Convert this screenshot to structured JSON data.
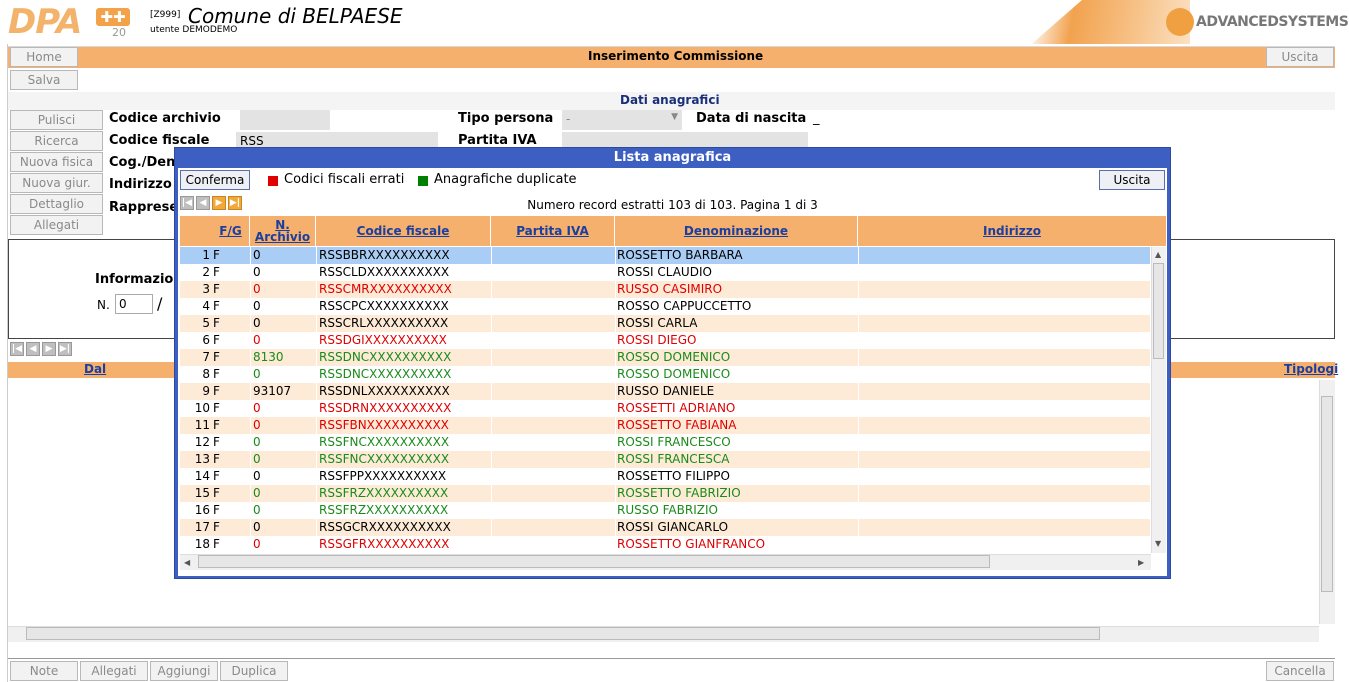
{
  "header": {
    "logo_text": "DPA",
    "logo_badge": "✚✚",
    "logo_version": "20",
    "comune_code": "[Z999]",
    "comune_name": "Comune di BELPAESE",
    "utente": "utente DEMODEMO",
    "vendor": "ADVANCEDSYSTEMS"
  },
  "topbar": {
    "home": "Home",
    "title": "Inserimento Commissione",
    "exit": "Uscita",
    "save": "Salva"
  },
  "section_title": "Dati anagrafici",
  "side_buttons": [
    "Pulisci",
    "Ricerca",
    "Nuova fisica",
    "Nuova giur.",
    "Dettaglio",
    "Allegati"
  ],
  "form": {
    "codice_archivio_label": "Codice archivio",
    "codice_archivio_value": "",
    "codice_fiscale_label": "Codice fiscale",
    "codice_fiscale_value": "RSS",
    "cog_label": "Cog./Den",
    "indirizzo_label": "Indirizzo",
    "rappresentante_label": "Rapprese",
    "tipo_persona_label": "Tipo persona",
    "tipo_persona_value": "-",
    "partita_iva_label": "Partita IVA",
    "data_nascita_label": "Data di nascita",
    "data_nascita_value": "_"
  },
  "info_panel": {
    "label": "Informazio",
    "n_label": "N.",
    "n_value": "0",
    "slash": "/"
  },
  "lower_grid": {
    "col_dal": "Dal",
    "col_tipologia": "Tipologi"
  },
  "bottom_buttons": [
    "Note",
    "Allegati",
    "Aggiungi",
    "Duplica"
  ],
  "cancel": "Cancella",
  "modal": {
    "title": "Lista anagrafica",
    "confirm": "Conferma",
    "exit": "Uscita",
    "legend_red": "Codici fiscali errati",
    "legend_green": "Anagrafiche duplicate",
    "records": "Numero record estratti 103 di 103. Pagina 1 di 3",
    "columns": {
      "fg": "F/G",
      "archivio": "N. Archivio",
      "cf": "Codice fiscale",
      "piva": "Partita IVA",
      "den": "Denominazione",
      "ind": "Indirizzo"
    },
    "rows": [
      {
        "n": "1",
        "fg": "F",
        "arch": "0",
        "cf": "RSSBBRXXXXXXXXXX",
        "den": "ROSSETTO BARBARA",
        "color": "black"
      },
      {
        "n": "2",
        "fg": "F",
        "arch": "0",
        "cf": "RSSCLDXXXXXXXXXX",
        "den": "ROSSI CLAUDIO",
        "color": "black"
      },
      {
        "n": "3",
        "fg": "F",
        "arch": "0",
        "cf": "RSSCMRXXXXXXXXXX",
        "den": "RUSSO CASIMIRO",
        "color": "red"
      },
      {
        "n": "4",
        "fg": "F",
        "arch": "0",
        "cf": "RSSCPCXXXXXXXXXX",
        "den": "ROSSO CAPPUCCETTO",
        "color": "black"
      },
      {
        "n": "5",
        "fg": "F",
        "arch": "0",
        "cf": "RSSCRLXXXXXXXXXX",
        "den": "ROSSI CARLA",
        "color": "black"
      },
      {
        "n": "6",
        "fg": "F",
        "arch": "0",
        "cf": "RSSDGIXXXXXXXXXX",
        "den": "ROSSI DIEGO",
        "color": "red"
      },
      {
        "n": "7",
        "fg": "F",
        "arch": "8130",
        "cf": "RSSDNCXXXXXXXXXX",
        "den": "ROSSO DOMENICO",
        "color": "green"
      },
      {
        "n": "8",
        "fg": "F",
        "arch": "0",
        "cf": "RSSDNCXXXXXXXXXX",
        "den": "ROSSO DOMENICO",
        "color": "green"
      },
      {
        "n": "9",
        "fg": "F",
        "arch": "93107",
        "cf": "RSSDNLXXXXXXXXXX",
        "den": "RUSSO DANIELE",
        "color": "black"
      },
      {
        "n": "10",
        "fg": "F",
        "arch": "0",
        "cf": "RSSDRNXXXXXXXXXX",
        "den": "ROSSETTI ADRIANO",
        "color": "red"
      },
      {
        "n": "11",
        "fg": "F",
        "arch": "0",
        "cf": "RSSFBNXXXXXXXXXX",
        "den": "ROSSETTO FABIANA",
        "color": "red"
      },
      {
        "n": "12",
        "fg": "F",
        "arch": "0",
        "cf": "RSSFNCXXXXXXXXXX",
        "den": "ROSSI FRANCESCO",
        "color": "green"
      },
      {
        "n": "13",
        "fg": "F",
        "arch": "0",
        "cf": "RSSFNCXXXXXXXXXX",
        "den": "ROSSI FRANCESCA",
        "color": "green"
      },
      {
        "n": "14",
        "fg": "F",
        "arch": "0",
        "cf": "RSSFPPXXXXXXXXXX",
        "den": "ROSSETTO FILIPPO",
        "color": "black"
      },
      {
        "n": "15",
        "fg": "F",
        "arch": "0",
        "cf": "RSSFRZXXXXXXXXXX",
        "den": "ROSSETTO FABRIZIO",
        "color": "green"
      },
      {
        "n": "16",
        "fg": "F",
        "arch": "0",
        "cf": "RSSFRZXXXXXXXXXX",
        "den": "RUSSO FABRIZIO",
        "color": "green"
      },
      {
        "n": "17",
        "fg": "F",
        "arch": "0",
        "cf": "RSSGCRXXXXXXXXXX",
        "den": "ROSSI GIANCARLO",
        "color": "black"
      },
      {
        "n": "18",
        "fg": "F",
        "arch": "0",
        "cf": "RSSGFRXXXXXXXXXX",
        "den": "ROSSETTO GIANFRANCO",
        "color": "red"
      }
    ]
  }
}
